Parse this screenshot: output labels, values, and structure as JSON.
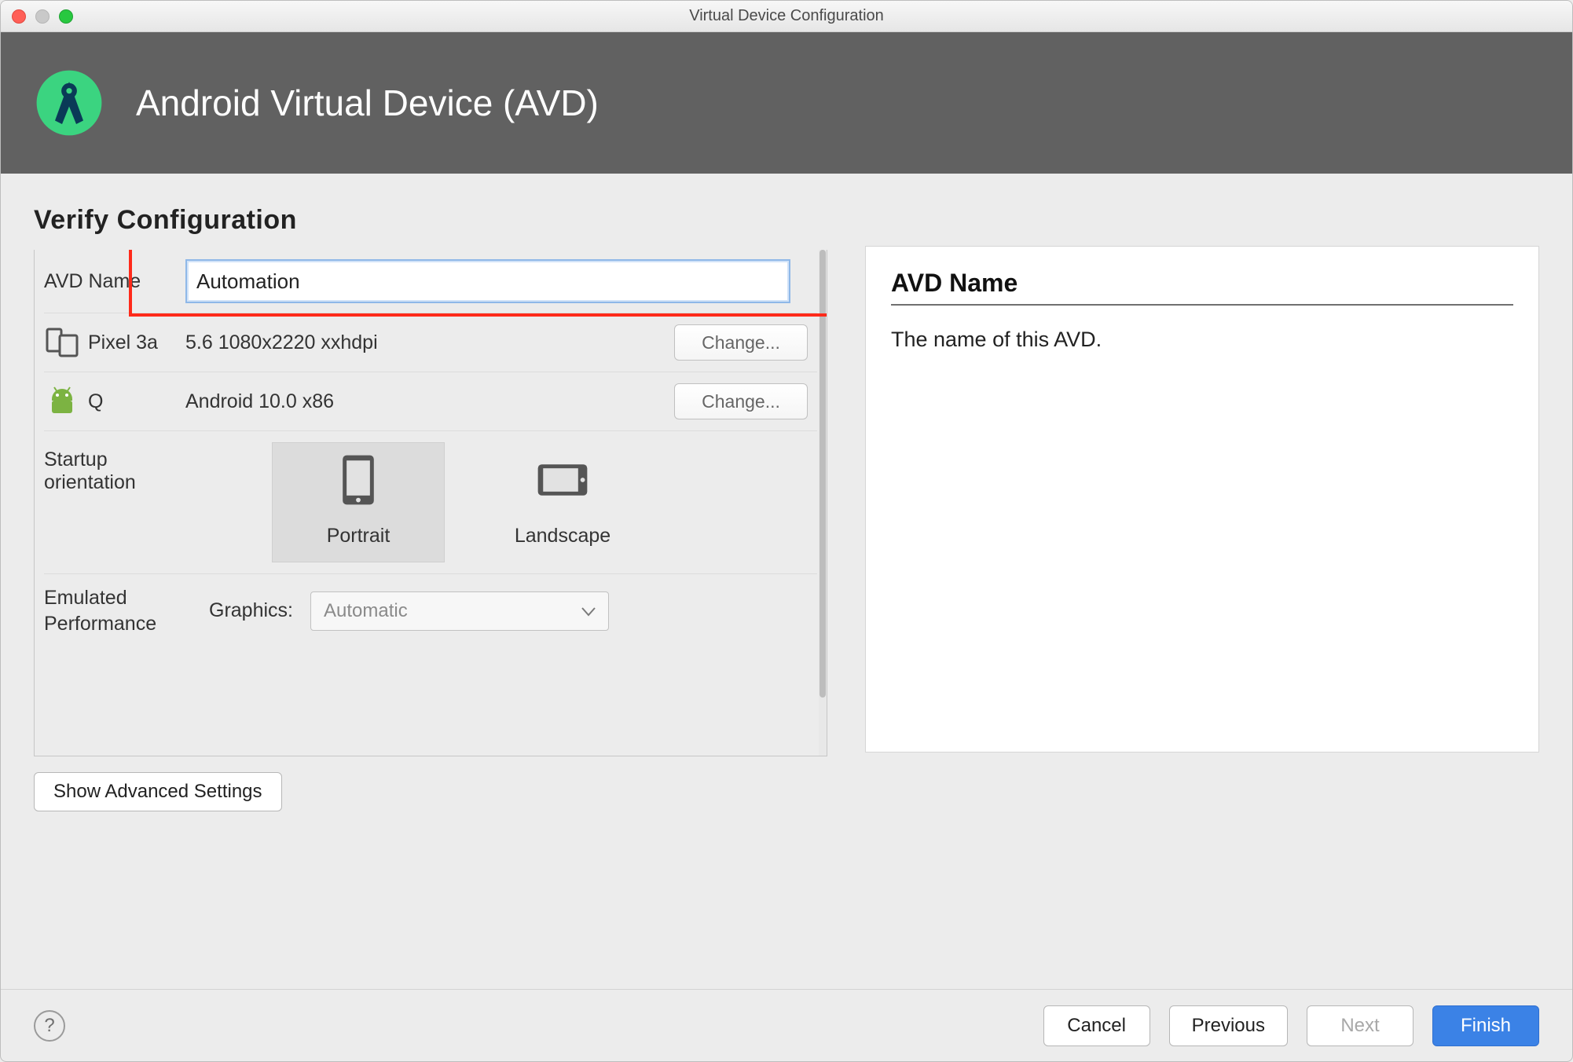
{
  "window": {
    "title": "Virtual Device Configuration"
  },
  "header": {
    "title": "Android Virtual Device (AVD)"
  },
  "section": {
    "title": "Verify Configuration"
  },
  "form": {
    "avd_name_label": "AVD Name",
    "avd_name_value": "Automation",
    "device": {
      "name": "Pixel 3a",
      "spec": "5.6 1080x2220 xxhdpi",
      "change_label": "Change..."
    },
    "system_image": {
      "name": "Q",
      "spec": "Android 10.0 x86",
      "change_label": "Change..."
    },
    "orientation": {
      "label": "Startup orientation",
      "portrait_label": "Portrait",
      "landscape_label": "Landscape"
    },
    "performance": {
      "label_line1": "Emulated",
      "label_line2": "Performance",
      "graphics_label": "Graphics:",
      "graphics_value": "Automatic"
    },
    "advanced_label": "Show Advanced Settings"
  },
  "info": {
    "title": "AVD Name",
    "body": "The name of this AVD."
  },
  "footer": {
    "cancel": "Cancel",
    "previous": "Previous",
    "next": "Next",
    "finish": "Finish"
  }
}
